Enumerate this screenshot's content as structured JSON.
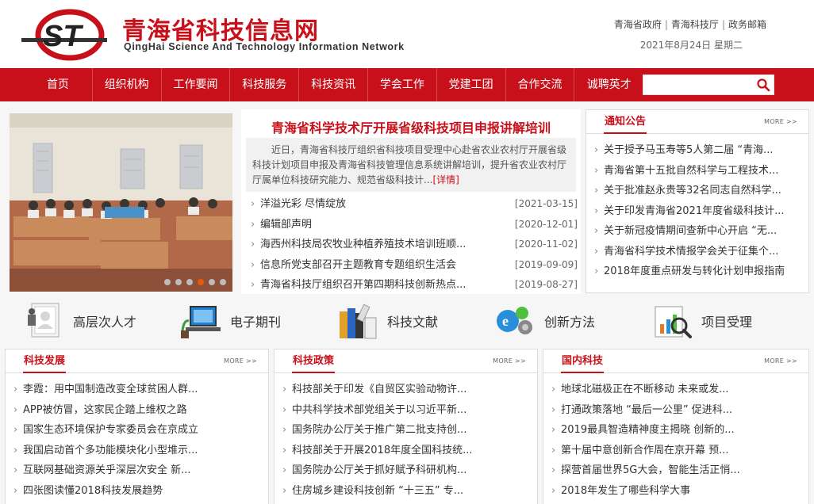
{
  "site": {
    "title_cn": "青海省科技信息网",
    "title_en": "QingHai Science And Technology Information Network",
    "logo_text": "ST"
  },
  "top_links": [
    "青海省政府",
    "青海科技厅",
    "政务邮箱"
  ],
  "date": "2021年8月24日  星期二",
  "nav": {
    "items": [
      "首页",
      "组织机构",
      "工作要闻",
      "科技服务",
      "科技资讯",
      "学会工作",
      "党建工团",
      "合作交流",
      "诚聘英才"
    ],
    "search_placeholder": ""
  },
  "slider": {
    "dots": 6,
    "active": 3
  },
  "headline": {
    "title": "青海省科学技术厅开展省级科技项目申报讲解培训",
    "summary": "近日，青海省科技厅组织省科技项目受理中心赴省农业农村厅开展省级科技计划项目申报及青海省科技管理信息系统讲解培训，提升省农业农村厅厅属单位科技研究能力、规范省级科技计...",
    "more": "[详情]"
  },
  "news": [
    {
      "title": "洋溢光彩 尽情绽放",
      "date": "[2021-03-15]"
    },
    {
      "title": "编辑部声明",
      "date": "[2020-12-01]"
    },
    {
      "title": "海西州科技局农牧业种植养殖技术培训班顺...",
      "date": "[2020-11-02]"
    },
    {
      "title": "信息所党支部召开主题教育专题组织生活会",
      "date": "[2019-09-09]"
    },
    {
      "title": "青海省科技厅组织召开第四期科技创新热点...",
      "date": "[2019-08-27]"
    }
  ],
  "notice": {
    "title": "通知公告",
    "more": "MORE >>",
    "items": [
      "关于授予马玉寿等5人第二届 “青海...",
      "青海省第十五批自然科学与工程技术...",
      "关于批准赵永贵等32名同志自然科学...",
      "关于印发青海省2021年度省级科技计...",
      "关于新冠疫情期间查新中心开启 “无...",
      "青海省科学技术情报学会关于征集个...",
      "2018年度重点研发与转化计划申报指南"
    ]
  },
  "services": [
    {
      "label": "高层次人才",
      "icon": "talent-icon"
    },
    {
      "label": "电子期刊",
      "icon": "ejournal-icon"
    },
    {
      "label": "科技文献",
      "icon": "literature-icon"
    },
    {
      "label": "创新方法",
      "icon": "innovation-icon"
    },
    {
      "label": "项目受理",
      "icon": "project-icon"
    }
  ],
  "sections": [
    {
      "title": "科技发展",
      "more": "MORE >>",
      "items": [
        "李霞：用中国制造改变全球贫困人群...",
        "APP被仿冒，这家民企踏上维权之路",
        "国家生态环境保护专家委员会在京成立",
        "我国启动首个多功能模块化小型堆示...",
        "互联网基础资源关乎深层次安全 新...",
        "四张图读懂2018科技发展趋势"
      ]
    },
    {
      "title": "科技政策",
      "more": "MORE >>",
      "items": [
        "科技部关于印发《自贸区实验动物许...",
        "中共科学技术部党组关于以习近平新...",
        "国务院办公厅关于推广第二批支持创...",
        "科技部关于开展2018年度全国科技统...",
        "国务院办公厅关于抓好赋予科研机构...",
        "住房城乡建设科技创新 “十三五” 专..."
      ]
    },
    {
      "title": "国内科技",
      "more": "MORE >>",
      "items": [
        "地球北磁极正在不断移动 未来或发...",
        "打通政策落地 “最后一公里” 促进科...",
        "2019最具智造精神度主揭晓 创新的...",
        "第十届中意创新合作周在京开幕 预...",
        "探营首届世界5G大会，智能生活正悄...",
        "2018年发生了哪些科学大事"
      ]
    }
  ],
  "colors": {
    "brand": "#c8101a",
    "accent": "#e8590c"
  }
}
